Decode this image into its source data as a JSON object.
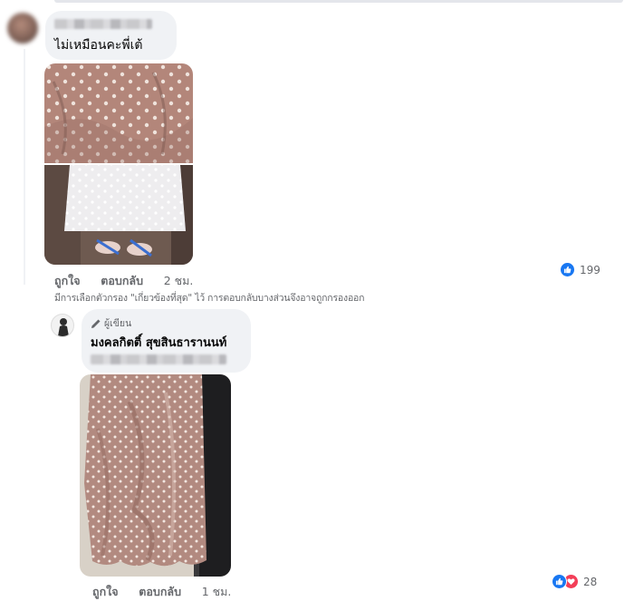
{
  "comment1": {
    "author": "",
    "text": "ไม่เหมือนคะพี่เต้",
    "actions": {
      "like": "ถูกใจ",
      "reply": "ตอบกลับ",
      "time": "2 ชม."
    },
    "reactions": {
      "icon": "like-icon",
      "count": "199"
    }
  },
  "filter_note": "มีการเลือกตัวกรอง \"เกี่ยวข้องที่สุด\" ไว้ การตอบกลับบางส่วนจึงอาจถูกกรองออก",
  "reply1": {
    "badge": "ผู้เขียน",
    "author": "มงคลกิตติ์ สุขสินธารานนท์",
    "actions": {
      "like": "ถูกใจ",
      "reply": "ตอบกลับ",
      "time": "1 ชม."
    },
    "reactions": {
      "icons": [
        "like-icon",
        "love-icon"
      ],
      "count": "28"
    }
  },
  "colors": {
    "like_blue": "#1877f2",
    "love_red": "#f33e58",
    "bubble": "#f0f2f5",
    "meta_gray": "#65676b"
  }
}
